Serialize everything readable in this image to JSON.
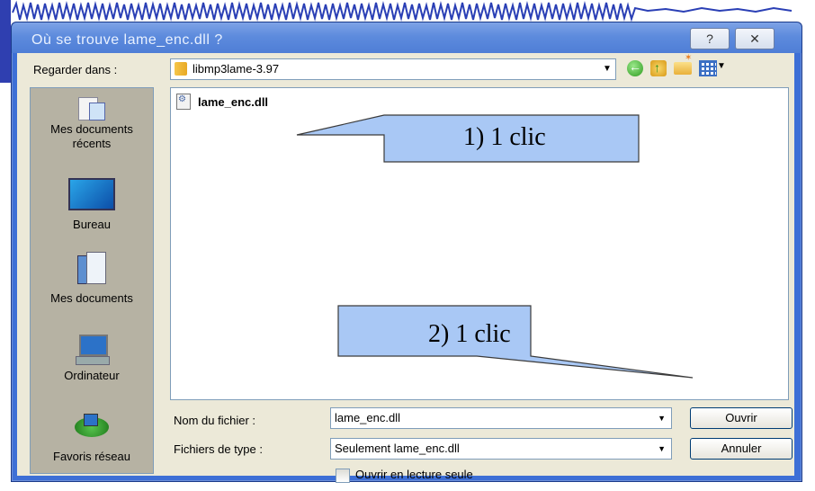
{
  "window": {
    "title": "Où se trouve  lame_enc.dll ?",
    "help_label": "?",
    "close_label": "✕"
  },
  "toolbar": {
    "lookin_label": "Regarder dans :",
    "lookin_value": "libmp3lame-3.97",
    "back_icon": "back-arrow-icon",
    "up_icon": "up-folder-icon",
    "new_folder_icon": "new-folder-icon",
    "views_icon": "views-menu-icon"
  },
  "places": [
    {
      "label": "Mes documents récents",
      "icon": "recent-documents-icon"
    },
    {
      "label": "Bureau",
      "icon": "desktop-icon"
    },
    {
      "label": "Mes documents",
      "icon": "my-documents-icon"
    },
    {
      "label": "Ordinateur",
      "icon": "computer-icon"
    },
    {
      "label": "Favoris réseau",
      "icon": "network-icon"
    }
  ],
  "files": [
    {
      "name": "lame_enc.dll",
      "icon": "dll-file-icon"
    }
  ],
  "form": {
    "filename_label": "Nom du fichier :",
    "filename_value": "lame_enc.dll",
    "filetype_label": "Fichiers de type :",
    "filetype_value": "Seulement lame_enc.dll",
    "readonly_label": "Ouvrir en lecture seule",
    "readonly_checked": false,
    "open_button": "Ouvrir",
    "cancel_button": "Annuler"
  },
  "annotations": [
    {
      "text": "1) 1 clic"
    },
    {
      "text": "2) 1 clic"
    }
  ],
  "colors": {
    "title_bar": "#5d8bdd",
    "dialog_bg": "#ece9d8",
    "callout_fill": "#a9c8f5"
  }
}
